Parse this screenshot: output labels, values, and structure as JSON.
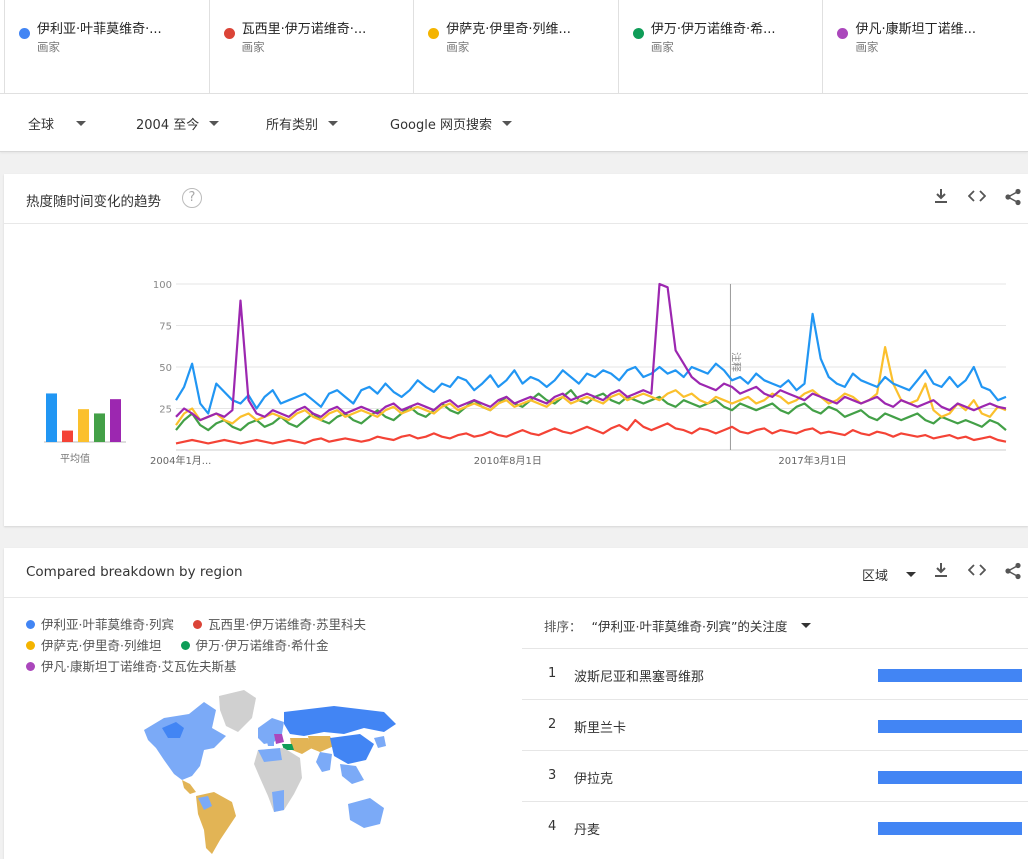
{
  "compare": [
    {
      "term": "伊利亚·叶菲莫维奇·...",
      "type": "画家",
      "color": "#4285f4"
    },
    {
      "term": "瓦西里·伊万诺维奇·...",
      "type": "画家",
      "color": "#db4437"
    },
    {
      "term": "伊萨克·伊里奇·列维...",
      "type": "画家",
      "color": "#f4b400"
    },
    {
      "term": "伊万·伊万诺维奇·希...",
      "type": "画家",
      "color": "#0f9d58"
    },
    {
      "term": "伊凡·康斯坦丁诺维...",
      "type": "画家",
      "color": "#ab47bc"
    }
  ],
  "filters": {
    "region": "全球",
    "time": "2004 至今",
    "category": "所有类别",
    "search_type": "Google 网页搜索"
  },
  "interest": {
    "title": "热度随时间变化的趋势",
    "help": "?",
    "avg_label": "平均值",
    "note_label": "注释"
  },
  "chart_data": {
    "type": "line",
    "title": "热度随时间变化的趋势",
    "ylim": [
      0,
      100
    ],
    "y_ticks": [
      "100",
      "75",
      "50",
      "25"
    ],
    "x_tick_labels": [
      "2004年1月...",
      "2010年8月1日",
      "2017年3月1日"
    ],
    "x_range": [
      "2004-01",
      "2020-08"
    ],
    "grid": true,
    "averages": [
      {
        "name": "伊利亚·叶菲莫维奇·列宾",
        "value": 34,
        "color": "#2196f3"
      },
      {
        "name": "瓦西里·伊万诺维奇·苏里科夫",
        "value": 8,
        "color": "#f44336"
      },
      {
        "name": "伊萨克·伊里奇·列维坦",
        "value": 23,
        "color": "#fbc02d"
      },
      {
        "name": "伊万·伊万诺维奇·希什金",
        "value": 20,
        "color": "#43a047"
      },
      {
        "name": "伊凡·康斯坦丁诺维奇·艾瓦佐夫斯基",
        "value": 30,
        "color": "#9c27b0"
      }
    ],
    "series": [
      {
        "name": "伊利亚·叶菲莫维奇·列宾",
        "color": "#2196f3",
        "values": [
          30,
          38,
          52,
          28,
          22,
          40,
          35,
          30,
          28,
          33,
          25,
          32,
          36,
          28,
          30,
          32,
          34,
          30,
          26,
          34,
          36,
          32,
          28,
          36,
          38,
          34,
          40,
          35,
          32,
          36,
          42,
          38,
          35,
          40,
          38,
          44,
          42,
          36,
          40,
          45,
          38,
          42,
          48,
          40,
          44,
          42,
          38,
          42,
          48,
          44,
          40,
          46,
          44,
          48,
          46,
          42,
          48,
          50,
          44,
          46,
          50,
          46,
          48,
          44,
          50,
          48,
          46,
          52,
          48,
          42,
          44,
          40,
          46,
          42,
          40,
          38,
          42,
          36,
          40,
          82,
          55,
          44,
          40,
          38,
          46,
          42,
          40,
          38,
          44,
          40,
          38,
          36,
          42,
          48,
          40,
          38,
          44,
          38,
          42,
          50,
          38,
          36,
          30,
          32
        ]
      },
      {
        "name": "瓦西里·伊万诺维奇·苏里科夫",
        "color": "#f44336",
        "values": [
          4,
          5,
          6,
          5,
          4,
          5,
          6,
          5,
          4,
          5,
          6,
          5,
          4,
          5,
          6,
          5,
          4,
          6,
          7,
          5,
          6,
          7,
          6,
          5,
          6,
          8,
          7,
          6,
          8,
          9,
          7,
          8,
          10,
          8,
          7,
          9,
          10,
          8,
          9,
          11,
          9,
          8,
          10,
          12,
          10,
          9,
          11,
          13,
          11,
          10,
          12,
          14,
          12,
          10,
          13,
          15,
          12,
          18,
          14,
          12,
          14,
          16,
          13,
          12,
          10,
          13,
          12,
          10,
          12,
          14,
          11,
          10,
          12,
          13,
          10,
          12,
          11,
          10,
          12,
          13,
          10,
          11,
          10,
          9,
          12,
          10,
          9,
          11,
          10,
          8,
          10,
          9,
          8,
          9,
          7,
          8,
          9,
          7,
          8,
          6,
          7,
          8,
          6,
          5
        ]
      },
      {
        "name": "伊萨克·伊里奇·列维坦",
        "color": "#fbc02d",
        "values": [
          15,
          22,
          25,
          18,
          20,
          22,
          18,
          16,
          20,
          22,
          18,
          20,
          22,
          20,
          18,
          22,
          24,
          20,
          18,
          22,
          24,
          20,
          22,
          24,
          22,
          20,
          24,
          26,
          22,
          24,
          26,
          24,
          22,
          26,
          28,
          24,
          26,
          28,
          26,
          24,
          28,
          30,
          26,
          28,
          30,
          28,
          26,
          30,
          32,
          28,
          30,
          32,
          30,
          28,
          32,
          34,
          30,
          32,
          34,
          32,
          30,
          34,
          36,
          32,
          34,
          30,
          28,
          32,
          30,
          28,
          30,
          32,
          28,
          30,
          34,
          32,
          28,
          30,
          34,
          36,
          32,
          28,
          30,
          34,
          32,
          28,
          30,
          34,
          62,
          40,
          30,
          28,
          30,
          40,
          24,
          20,
          22,
          28,
          24,
          30,
          22,
          20,
          26,
          24
        ]
      },
      {
        "name": "伊万·伊万诺维奇·希什金",
        "color": "#43a047",
        "values": [
          12,
          18,
          22,
          15,
          12,
          16,
          18,
          14,
          12,
          16,
          18,
          14,
          16,
          20,
          16,
          14,
          18,
          22,
          18,
          16,
          20,
          22,
          18,
          16,
          20,
          24,
          20,
          18,
          22,
          26,
          22,
          20,
          24,
          28,
          24,
          22,
          26,
          30,
          26,
          24,
          28,
          32,
          28,
          26,
          30,
          34,
          30,
          28,
          32,
          36,
          30,
          28,
          32,
          34,
          30,
          28,
          32,
          30,
          28,
          30,
          32,
          28,
          26,
          30,
          28,
          26,
          28,
          30,
          26,
          24,
          28,
          26,
          24,
          26,
          28,
          24,
          22,
          26,
          28,
          24,
          22,
          26,
          24,
          20,
          22,
          24,
          20,
          18,
          22,
          20,
          18,
          20,
          22,
          18,
          16,
          20,
          18,
          16,
          18,
          16,
          14,
          18,
          16,
          12
        ]
      },
      {
        "name": "伊凡·康斯坦丁诺维奇·艾瓦佐夫斯基",
        "color": "#9c27b0",
        "values": [
          20,
          25,
          22,
          18,
          20,
          22,
          20,
          24,
          90,
          30,
          22,
          20,
          24,
          22,
          20,
          24,
          26,
          22,
          20,
          24,
          26,
          22,
          24,
          26,
          24,
          22,
          26,
          28,
          24,
          26,
          28,
          26,
          24,
          28,
          30,
          26,
          28,
          30,
          28,
          26,
          30,
          32,
          28,
          30,
          32,
          30,
          28,
          32,
          34,
          30,
          32,
          34,
          32,
          30,
          34,
          36,
          32,
          34,
          36,
          34,
          100,
          98,
          60,
          52,
          44,
          40,
          38,
          36,
          40,
          38,
          34,
          36,
          38,
          34,
          32,
          36,
          34,
          32,
          30,
          34,
          32,
          30,
          28,
          32,
          30,
          28,
          30,
          32,
          28,
          26,
          30,
          28,
          26,
          28,
          30,
          26,
          24,
          28,
          26,
          24,
          26,
          28,
          26,
          25
        ]
      }
    ]
  },
  "region": {
    "title": "Compared breakdown by region",
    "view_label": "区域",
    "legend": [
      {
        "label": "伊利亚·叶菲莫维奇·列宾",
        "color": "#4285f4"
      },
      {
        "label": "瓦西里·伊万诺维奇·苏里科夫",
        "color": "#db4437"
      },
      {
        "label": "伊萨克·伊里奇·列维坦",
        "color": "#f4b400"
      },
      {
        "label": "伊万·伊万诺维奇·希什金",
        "color": "#0f9d58"
      },
      {
        "label": "伊凡·康斯坦丁诺维奇·艾瓦佐夫斯基",
        "color": "#ab47bc"
      }
    ],
    "sort_label": "排序：",
    "sort_value": "“伊利亚·叶菲莫维奇·列宾”的关注度",
    "ranks": [
      {
        "num": "1",
        "name": "波斯尼亚和黑塞哥维那",
        "value": 100
      },
      {
        "num": "2",
        "name": "斯里兰卡",
        "value": 100
      },
      {
        "num": "3",
        "name": "伊拉克",
        "value": 100
      },
      {
        "num": "4",
        "name": "丹麦",
        "value": 100
      }
    ]
  }
}
